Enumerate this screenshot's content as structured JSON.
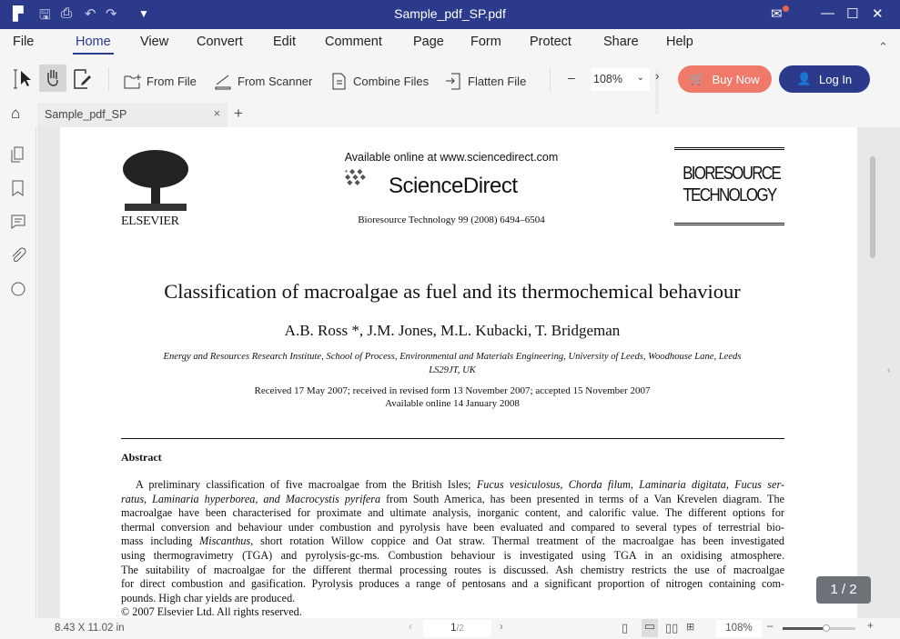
{
  "window": {
    "title": "Sample_pdf_SP.pdf"
  },
  "menu": [
    {
      "label": "File"
    },
    {
      "label": "Home",
      "active": true
    },
    {
      "label": "View"
    },
    {
      "label": "Convert"
    },
    {
      "label": "Edit"
    },
    {
      "label": "Comment"
    },
    {
      "label": "Page"
    },
    {
      "label": "Form"
    },
    {
      "label": "Protect"
    },
    {
      "label": "Share"
    },
    {
      "label": "Help"
    }
  ],
  "toolbar": {
    "from_file": "From File",
    "from_scanner": "From Scanner",
    "combine_files": "Combine Files",
    "flatten_file": "Flatten File",
    "zoom": "108%",
    "buy_now": "Buy Now",
    "log_in": "Log In"
  },
  "colors": {
    "brand": "#2c3a8c",
    "buy_now": "#f07a6a",
    "log_in": "#2c3a8c"
  },
  "tabs": [
    {
      "label": "Sample_pdf_SP"
    }
  ],
  "document": {
    "available_online": "Available online at www.sciencedirect.com",
    "sciencedirect": "ScienceDirect",
    "publisher": "ELSEVIER",
    "journal_logo": "BIORESOURCE TECHNOLOGY",
    "citation": "Bioresource Technology 99 (2008) 6494–6504",
    "title": "Classification of macroalgae as fuel and its thermochemical behaviour",
    "authors": "A.B. Ross *, J.M. Jones, M.L. Kubacki, T. Bridgeman",
    "affiliation_1": "Energy and Resources Research Institute, School of Process, Environmental and Materials Engineering, University of Leeds, Woodhouse Lane, Leeds",
    "affiliation_2": "LS29JT, UK",
    "received": "Received 17 May 2007; received in revised form 13 November 2007; accepted 15 November 2007",
    "available": "Available online 14 January 2008",
    "abstract_heading": "Abstract",
    "abstract_lines": [
      [
        {
          "t": "A preliminary classification of five macroalgae from the British Isles; "
        },
        {
          "t": "Fucus vesiculosus, Chorda filum, Laminaria digitata, Fucus ser-",
          "i": true
        }
      ],
      [
        {
          "t": "ratus, Laminaria hyperborea, and Macrocystis pyrifera",
          "i": true
        },
        {
          "t": " from South America, has been presented in terms of a Van Krevelen diagram. The"
        }
      ],
      [
        {
          "t": "macroalgae have been characterised for proximate and ultimate analysis, inorganic content, and calorific value. The different options for"
        }
      ],
      [
        {
          "t": "thermal conversion and behaviour under combustion and pyrolysis have been evaluated and compared to several types of terrestrial bio-"
        }
      ],
      [
        {
          "t": "mass including "
        },
        {
          "t": "Miscanthus",
          "i": true
        },
        {
          "t": ", short rotation Willow coppice and Oat straw. Thermal treatment of the macroalgae has been investigated"
        }
      ],
      [
        {
          "t": "using thermogravimetry (TGA) and pyrolysis-gc-ms. Combustion behaviour is investigated using TGA in an oxidising atmosphere."
        }
      ],
      [
        {
          "t": "The suitability of macroalgae for the different thermal processing routes is discussed. Ash chemistry restricts the use of macroalgae"
        }
      ],
      [
        {
          "t": "for direct combustion and gasification. Pyrolysis produces a range of pentosans and a significant proportion of nitrogen containing com-"
        }
      ],
      [
        {
          "t": "pounds. High char yields are produced."
        }
      ],
      [
        {
          "t": "© 2007 Elsevier Ltd. All rights reserved."
        }
      ]
    ]
  },
  "page_badge": "1 / 2",
  "status": {
    "page_size": "8.43 X 11.02 in",
    "current_page": "1",
    "total_pages": "/2",
    "zoom": "108%",
    "zoom_slider_percent": 60
  }
}
